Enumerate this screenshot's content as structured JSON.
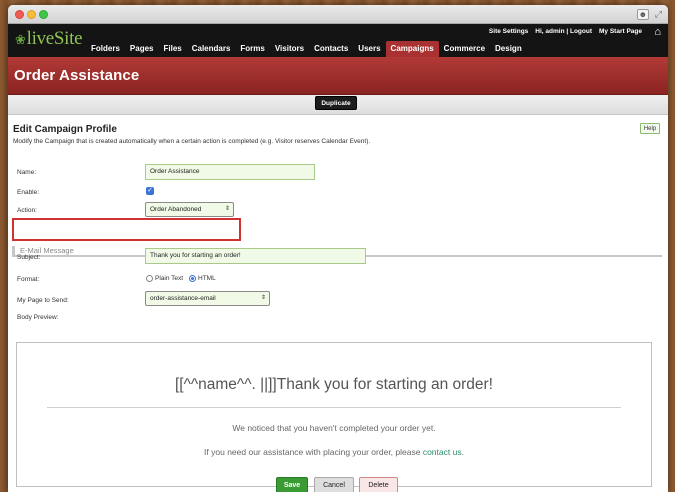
{
  "nav": {
    "logo": "liveSite",
    "items": [
      "Folders",
      "Pages",
      "Files",
      "Calendars",
      "Forms",
      "Visitors",
      "Contacts",
      "Users",
      "Campaigns",
      "Commerce",
      "Design"
    ],
    "active": "Campaigns",
    "util_links": [
      "Site Settings",
      "Hi, admin | Logout",
      "My Start Page"
    ]
  },
  "banner": {
    "title": "Order Assistance"
  },
  "toolbar": {
    "duplicate_label": "Duplicate"
  },
  "page": {
    "title": "Edit Campaign Profile",
    "description": "Modify the Campaign that is created automatically when a certain action is completed (e.g. Visitor reserves Calendar Event).",
    "help_label": "Help"
  },
  "form": {
    "name_label": "Name:",
    "name_value": "Order Assistance",
    "enable_label": "Enable:",
    "enable_checked": true,
    "action_label": "Action:",
    "action_value": "Order Abandoned",
    "section_title": "E-Mail Message",
    "subject_label": "Subject:",
    "subject_value": "Thank you for starting an order!",
    "format_label": "Format:",
    "format_options": [
      "Plain Text",
      "HTML"
    ],
    "format_selected": "HTML",
    "page_label": "My Page to Send:",
    "page_value": "order-assistance-email",
    "body_label": "Body Preview:"
  },
  "preview": {
    "heading": "[[^^name^^. ||]]Thank you for starting an order!",
    "line1": "We noticed that you haven't completed your order yet.",
    "line2_prefix": "If you need our assistance with placing your order, please ",
    "line2_link": "contact us",
    "line2_suffix": "."
  },
  "buttons": {
    "save": "Save",
    "cancel": "Cancel",
    "delete": "Delete"
  },
  "colors": {
    "nav_active": "#a93131",
    "banner": "#9e2f2c",
    "accent_green": "#3a9a33",
    "highlight": "#d0322f"
  }
}
